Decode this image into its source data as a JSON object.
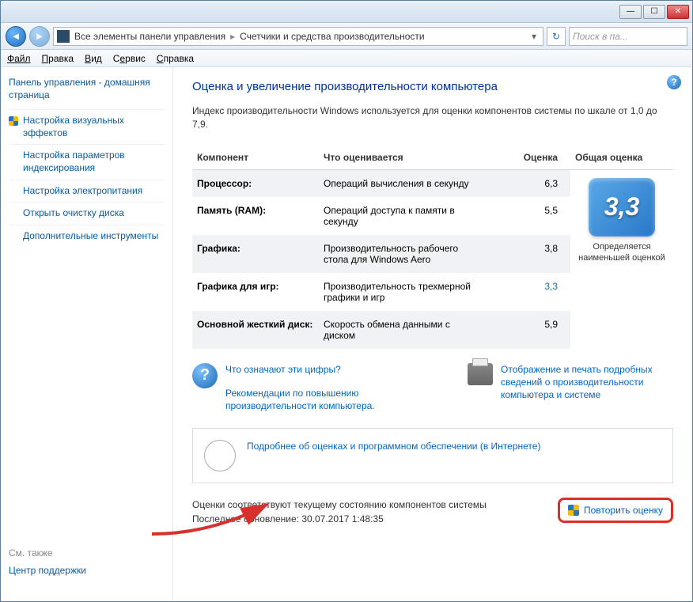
{
  "titlebar": {
    "min": "—",
    "max": "☐",
    "close": "✕"
  },
  "breadcrumb": {
    "item1": "Все элементы панели управления",
    "item2": "Счетчики и средства производительности"
  },
  "search": {
    "placeholder": "Поиск в па..."
  },
  "menu": {
    "file": "Файл",
    "edit": "Правка",
    "view": "Вид",
    "service": "Сервис",
    "help": "Справка"
  },
  "sidebar": {
    "home": "Панель управления - домашняя страница",
    "items": [
      "Настройка визуальных эффектов",
      "Настройка параметров индексирования",
      "Настройка электропитания",
      "Открыть очистку диска",
      "Дополнительные инструменты"
    ],
    "also_label": "См. также",
    "also_link": "Центр поддержки"
  },
  "main": {
    "title": "Оценка и увеличение производительности компьютера",
    "desc": "Индекс производительности Windows используется для оценки компонентов системы по шкале от 1,0 до 7,9.",
    "th_component": "Компонент",
    "th_what": "Что оценивается",
    "th_score": "Оценка",
    "th_overall": "Общая оценка",
    "rows": [
      {
        "name": "Процессор:",
        "what": "Операций вычисления в секунду",
        "score": "6,3"
      },
      {
        "name": "Память (RAM):",
        "what": "Операций доступа к памяти в секунду",
        "score": "5,5"
      },
      {
        "name": "Графика:",
        "what": "Производительность рабочего стола для Windows Aero",
        "score": "3,8"
      },
      {
        "name": "Графика для игр:",
        "what": "Производительность трехмерной графики и игр",
        "score": "3,3"
      },
      {
        "name": "Основной жесткий диск:",
        "what": "Скорость обмена данными с диском",
        "score": "5,9"
      }
    ],
    "overall_score": "3,3",
    "overall_txt": "Определяется наименьшей оценкой",
    "link_what": "Что означают эти цифры?",
    "link_rec": "Рекомендации по повышению производительности компьютера.",
    "link_print": "Отображение и печать подробных сведений о производительности компьютера и системе",
    "link_info": "Подробнее об оценках и программном обеспечении (в Интернете)",
    "status1": "Оценки соответствуют текущему состоянию компонентов системы",
    "status2": "Последнее обновление: 30.07.2017 1:48:35",
    "rerun": "Повторить оценку"
  }
}
